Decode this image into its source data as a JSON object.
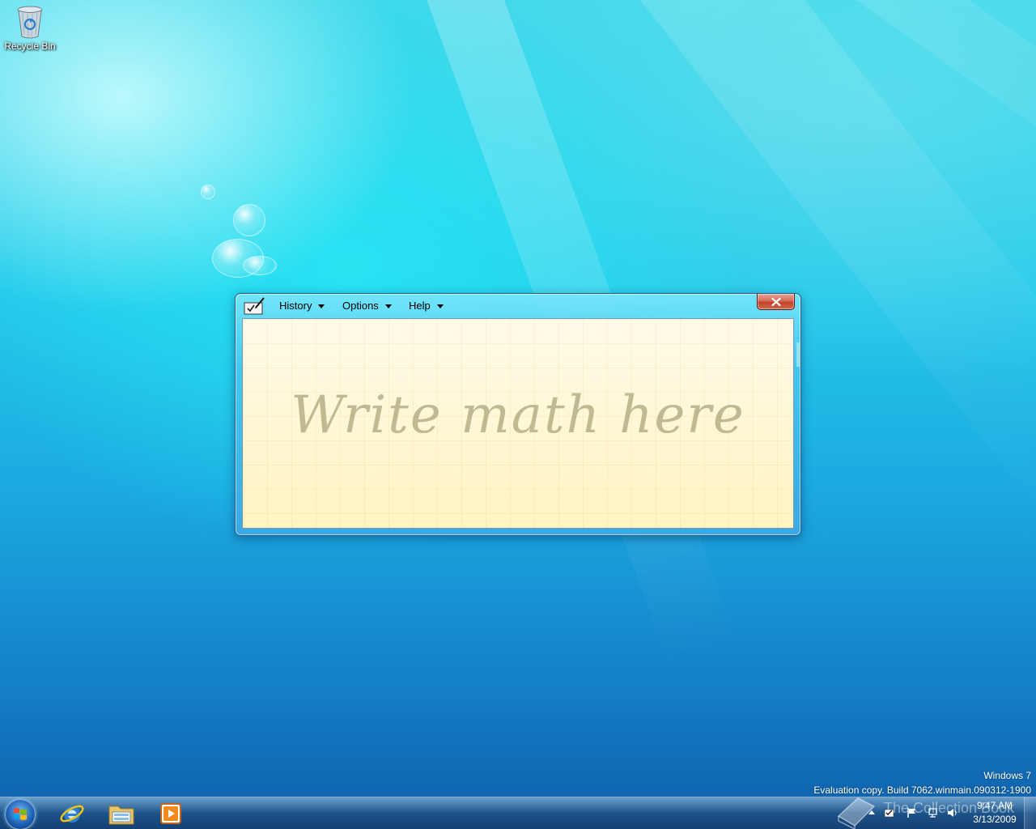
{
  "desktop": {
    "icons": [
      {
        "label": "Recycle Bin",
        "icon": "recycle-bin-icon"
      }
    ]
  },
  "math_panel": {
    "menus": [
      {
        "label": "History"
      },
      {
        "label": "Options"
      },
      {
        "label": "Help"
      }
    ],
    "close_label": "×",
    "canvas_hint": "Write math here",
    "canvas_color": "#fff6d2"
  },
  "watermark": {
    "line1": "Windows 7",
    "line2": "Evaluation copy. Build 7062.winmain.090312-1900",
    "overlay": "The Collection Book"
  },
  "taskbar": {
    "pinned": [
      {
        "name": "internet-explorer-icon"
      },
      {
        "name": "windows-explorer-icon"
      },
      {
        "name": "media-player-icon"
      }
    ],
    "tray": {
      "icons": [
        "show-hidden-icons-arrow",
        "action-center-icon",
        "flag-icon",
        "network-icon",
        "volume-icon"
      ]
    },
    "clock": {
      "time": "9:47 AM",
      "date": "3/13/2009"
    }
  }
}
